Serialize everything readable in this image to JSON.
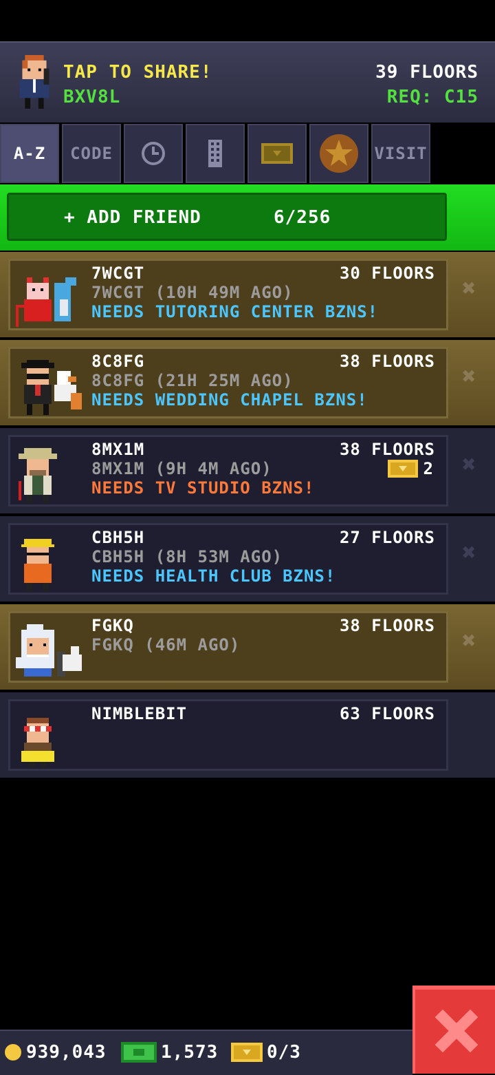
{
  "header": {
    "share_label": "TAP TO SHARE!",
    "friend_code": "BXV8L",
    "floors": "39 FLOORS",
    "requirement": "REQ: C15"
  },
  "tabs": [
    {
      "label": "A-Z",
      "active": true
    },
    {
      "label": "CODE"
    },
    {
      "icon": "clock-icon"
    },
    {
      "icon": "building-icon"
    },
    {
      "icon": "ticket-icon"
    },
    {
      "icon": "star-medal-icon"
    },
    {
      "label": "VISIT"
    }
  ],
  "add_friend": {
    "label": "+ ADD FRIEND",
    "count": "6/256"
  },
  "friends": [
    {
      "name": "7WCGT",
      "floors": "30 FLOORS",
      "sub": "7WCGT (10H 49M AGO)",
      "need": "NEEDS TUTORING CENTER BZNS!",
      "need_color": "blue",
      "style": "gold"
    },
    {
      "name": "8C8FG",
      "floors": "38 FLOORS",
      "sub": "8C8FG (21H 25M AGO)",
      "need": "NEEDS WEDDING CHAPEL BZNS!",
      "need_color": "blue",
      "style": "gold"
    },
    {
      "name": "8MX1M",
      "floors": "38 FLOORS",
      "sub": "8MX1M (9H 4M AGO)",
      "need": "NEEDS TV STUDIO BZNS!",
      "need_color": "orange",
      "tickets": "2",
      "style": "dark"
    },
    {
      "name": "CBH5H",
      "floors": "27 FLOORS",
      "sub": "CBH5H (8H 53M AGO)",
      "need": "NEEDS HEALTH CLUB BZNS!",
      "need_color": "blue",
      "style": "dark"
    },
    {
      "name": "FGKQ",
      "floors": "38 FLOORS",
      "sub": "FGKQ (46M AGO)",
      "need": "",
      "style": "gold"
    },
    {
      "name": "NIMBLEBIT",
      "floors": "63 FLOORS",
      "sub": "",
      "need": "",
      "style": "dark"
    }
  ],
  "status_bar": {
    "coins": "939,043",
    "bux": "1,573",
    "tickets": "0/3"
  },
  "colors": {
    "accent_green": "#13b713",
    "close_red": "#e53a3a",
    "gold": "#f5c842"
  }
}
